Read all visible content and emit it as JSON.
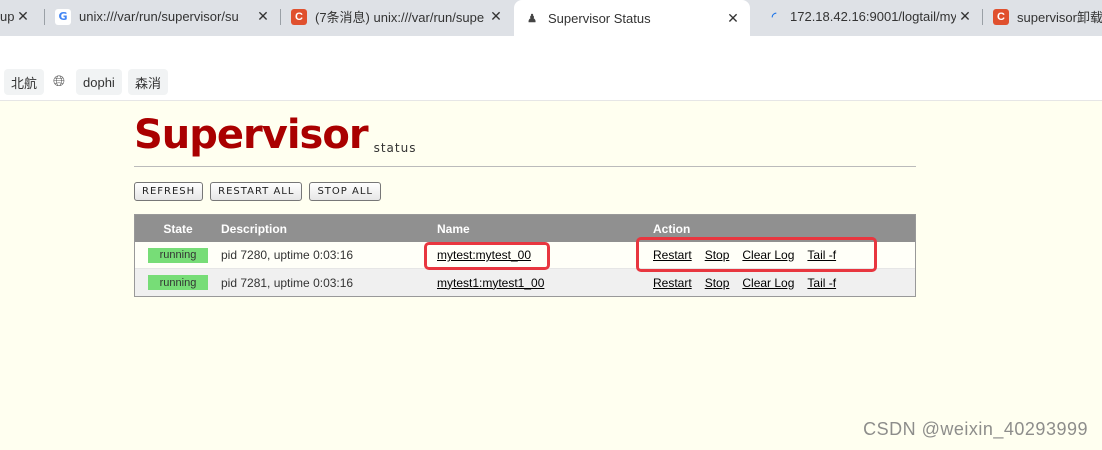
{
  "browser": {
    "tabs": [
      {
        "title": "up",
        "favicon": "generic"
      },
      {
        "title": "unix:///var/run/supervisor/su",
        "favicon": "google"
      },
      {
        "title": "(7条消息) unix:///var/run/supe",
        "favicon": "csdn"
      },
      {
        "title": "Supervisor Status",
        "favicon": "person",
        "active": true
      },
      {
        "title": "172.18.42.16:9001/logtail/my",
        "favicon": "loading"
      },
      {
        "title": "supervisor卸载",
        "favicon": "csdn"
      }
    ],
    "close_glyph": "✕"
  },
  "bookmarks": {
    "items": [
      "北航",
      "dophi",
      "森消"
    ],
    "globe_icon": "globe-icon"
  },
  "page": {
    "logo_main": "Supervisor",
    "logo_sub": "status",
    "buttons": {
      "refresh": "REFRESH",
      "restart_all": "RESTART ALL",
      "stop_all": "STOP ALL"
    },
    "table": {
      "headers": {
        "state": "State",
        "description": "Description",
        "name": "Name",
        "action": "Action"
      },
      "rows": [
        {
          "state": "running",
          "description": "pid 7280, uptime 0:03:16",
          "name": "mytest:mytest_00",
          "actions": {
            "restart": "Restart",
            "stop": "Stop",
            "clear_log": "Clear Log",
            "tail": "Tail -f"
          }
        },
        {
          "state": "running",
          "description": "pid 7281, uptime 0:03:16",
          "name": "mytest1:mytest1_00",
          "actions": {
            "restart": "Restart",
            "stop": "Stop",
            "clear_log": "Clear Log",
            "tail": "Tail -f"
          }
        }
      ]
    }
  },
  "watermark": "CSDN @weixin_40293999",
  "colors": {
    "logo": "#aa0000",
    "running_badge": "#77dd77",
    "header_bg": "#909090",
    "highlight": "#e8363f"
  }
}
